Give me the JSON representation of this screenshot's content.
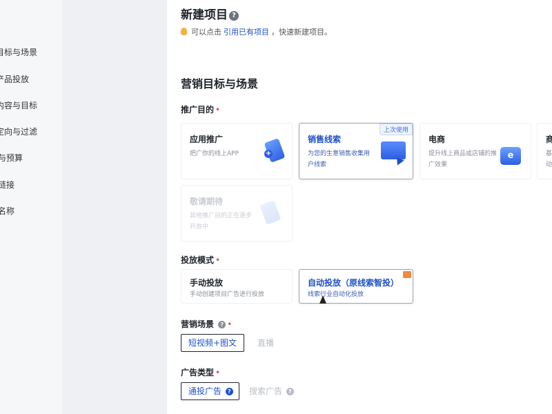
{
  "sidebar": {
    "items": [
      {
        "label": "目标与场景"
      },
      {
        "label": "产品投放"
      },
      {
        "label": "内容与目标"
      },
      {
        "label": "定向与过滤"
      },
      {
        "label": "与预算"
      },
      {
        "label": "链接"
      },
      {
        "label": "名称"
      }
    ]
  },
  "header": {
    "title": "新建项目",
    "hint_prefix": "可以点击",
    "hint_link": "引用已有项目",
    "hint_suffix": "，快速新建项目。"
  },
  "section": {
    "title": "营销目标与场景"
  },
  "purpose": {
    "label": "推广目的",
    "cards": [
      {
        "title": "应用推广",
        "desc": "把广你的线上APP"
      },
      {
        "title": "销售线索",
        "desc": "为您的生意销售收集用户线索",
        "badge": "上次使用"
      },
      {
        "title": "电商",
        "desc": "提升线上商品或店铺的推广效果"
      },
      {
        "title": "商",
        "desc": "基动"
      },
      {
        "title": "敬请期待",
        "desc": "其他推广目的正在逐步开放中"
      }
    ]
  },
  "mode": {
    "label": "投放模式",
    "cards": [
      {
        "title": "手动投放",
        "desc": "手动创建项目广告进行投放"
      },
      {
        "title": "自动投放（原线索智投）",
        "desc": "线索行业自动化投放"
      }
    ]
  },
  "scene": {
    "label": "营销场景",
    "options": [
      {
        "label": "短视频+图文"
      },
      {
        "label": "直播"
      }
    ]
  },
  "adtype": {
    "label": "广告类型",
    "options": [
      {
        "label": "通投广告"
      },
      {
        "label": "搜索广告"
      }
    ]
  },
  "colors": {
    "accent": "#1d50c8",
    "required": "#e34d59"
  }
}
